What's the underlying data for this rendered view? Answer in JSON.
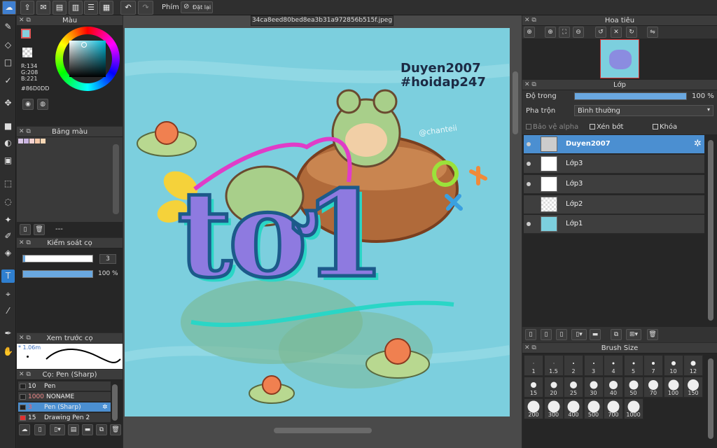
{
  "toolbar": {
    "filter_label": "Phím",
    "reset_label": "Đặt lại"
  },
  "document": {
    "filename": "34ca8eed80bed8ea3b31a972856b515f.jpeg"
  },
  "color_panel": {
    "title": "Màu",
    "r": "R:134",
    "g": "G:208",
    "b": "B:221",
    "hex": "#86D0DD",
    "current_color": "#86D0DD"
  },
  "palette_panel": {
    "title": "Bảng màu",
    "swatches": [
      "#d9c7e6",
      "#c9b3e0",
      "#f3d2d0",
      "#f5c8a8",
      "#f7d7b5"
    ],
    "footer_text": "---"
  },
  "brush_control": {
    "title": "Kiểm soát cọ",
    "size_value": "3",
    "opacity_value": "100 %",
    "size_fraction": 0.03,
    "opacity_fraction": 1.0
  },
  "brush_preview": {
    "title": "Xem trước cọ",
    "size_text": "* 1.06m"
  },
  "brush_list": {
    "title": "Cọ: Pen (Sharp)",
    "items": [
      {
        "num": "10",
        "name": "Pen",
        "color": "#222222"
      },
      {
        "num": "1000",
        "name": "NONAME",
        "color": "#222222"
      },
      {
        "num": "3",
        "name": "Pen (Sharp)",
        "color": "#222222"
      },
      {
        "num": "15",
        "name": "Drawing Pen 2",
        "color": "#e03030"
      }
    ]
  },
  "artwork": {
    "watermark_line1": "Duyen2007",
    "watermark_line2": "#hoidap247",
    "credit": "@chanteii",
    "big_text": "tơ1"
  },
  "navigator": {
    "title": "Hoa tiêu"
  },
  "layer_panel": {
    "title": "Lớp",
    "opacity_label": "Độ trong",
    "opacity_value": "100 %",
    "blend_label": "Pha trộn",
    "blend_value": "Bình thường",
    "protect_alpha": "Bảo vệ alpha",
    "clip": "Xén bớt",
    "lock": "Khóa",
    "layers": [
      {
        "name": "Duyen2007"
      },
      {
        "name": "Lớp3"
      },
      {
        "name": "Lớp3"
      },
      {
        "name": "Lớp2"
      },
      {
        "name": "Lớp1"
      }
    ]
  },
  "brush_size": {
    "title": "Brush Size",
    "sizes": [
      "1",
      "1.5",
      "2",
      "3",
      "4",
      "5",
      "7",
      "10",
      "12",
      "15",
      "20",
      "25",
      "30",
      "40",
      "50",
      "70",
      "100",
      "150",
      "200",
      "300",
      "400",
      "500",
      "700",
      "1000"
    ]
  }
}
